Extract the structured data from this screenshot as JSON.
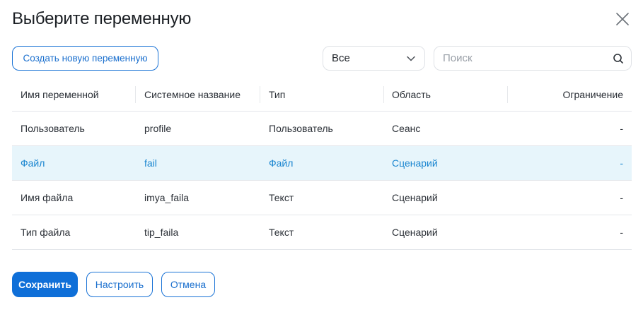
{
  "dialog": {
    "title": "Выберите переменную"
  },
  "toolbar": {
    "create_label": "Создать новую переменную",
    "filter_value": "Все",
    "search_placeholder": "Поиск"
  },
  "table": {
    "columns": [
      "Имя переменной",
      "Системное название",
      "Тип",
      "Область",
      "Ограничение"
    ],
    "rows": [
      [
        "Пользователь",
        "profile",
        "Пользователь",
        "Сеанс",
        "-"
      ],
      [
        "Файл",
        "fail",
        "Файл",
        "Сценарий",
        "-"
      ],
      [
        "Имя файла",
        "imya_faila",
        "Текст",
        "Сценарий",
        "-"
      ],
      [
        "Тип файла",
        "tip_faila",
        "Текст",
        "Сценарий",
        "-"
      ]
    ],
    "selected_row": 1
  },
  "footer": {
    "save_label": "Сохранить",
    "configure_label": "Настроить",
    "cancel_label": "Отмена"
  },
  "colors": {
    "accent": "#0f6fd8",
    "selected_bg": "#e7f5fb",
    "selected_text": "#1b86d0"
  },
  "icons": {
    "close": "close-icon",
    "dropdown": "chevron-down-icon",
    "search": "search-icon"
  }
}
